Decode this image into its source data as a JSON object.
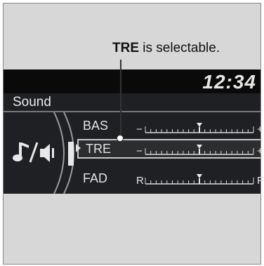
{
  "callout": {
    "bold": "TRE",
    "rest": " is selectable."
  },
  "screen": {
    "clock": "12:34",
    "section": "Sound",
    "rows": [
      {
        "label": "BAS",
        "left": "−",
        "right": "+",
        "level": 0.5
      },
      {
        "label": "TRE",
        "left": "−",
        "right": "+",
        "level": 0.5,
        "selected": true
      },
      {
        "label": "FAD",
        "left": "R",
        "right": "F",
        "level": 0.5
      }
    ],
    "icon": "music-speaker-icon"
  },
  "colors": {
    "screen_bg": "#1f2023",
    "topbar_bg": "#0a0a0b",
    "frame_bg": "#d7d7d8",
    "text": "#e3e3e3"
  }
}
